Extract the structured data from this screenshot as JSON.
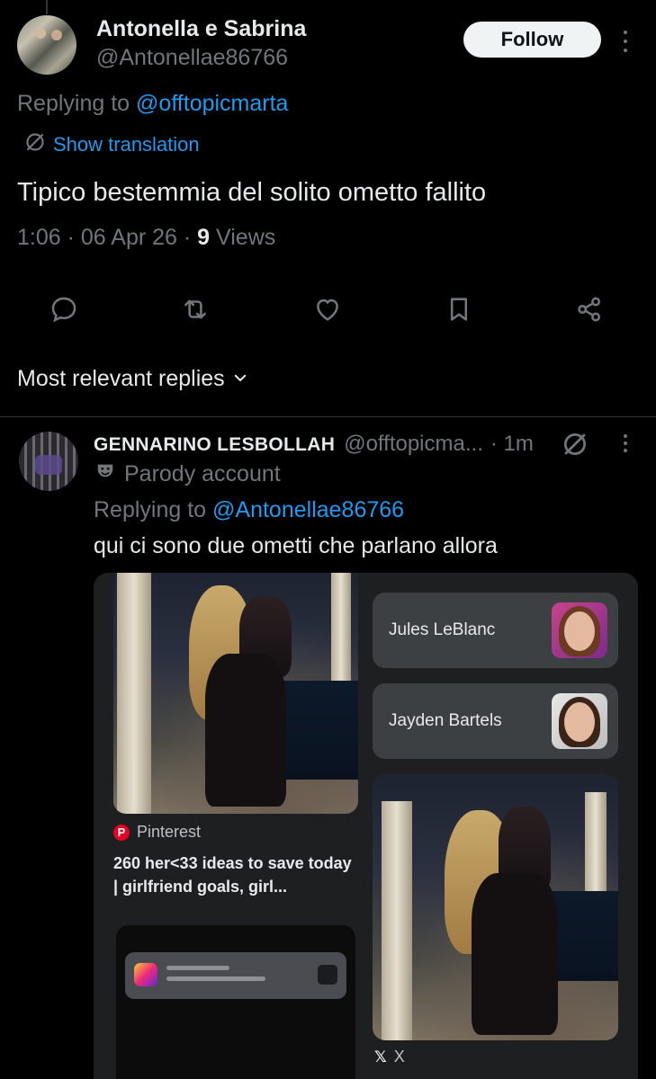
{
  "tweet": {
    "author_name": "Antonella e Sabrina",
    "author_handle": "@Antonellae86766",
    "follow_label": "Follow",
    "replying_prefix": "Replying to",
    "replying_to": "@offtopicmarta",
    "translate_label": "Show translation",
    "text": "Tipico bestemmia del solito ometto fallito",
    "time": "1:06",
    "date": "06 Apr 26",
    "views_count": "9",
    "views_label": "Views",
    "separator": "·"
  },
  "actions": [
    "reply-icon",
    "retweet-icon",
    "like-icon",
    "bookmark-icon",
    "share-icon"
  ],
  "replies_sort": {
    "label": "Most relevant replies"
  },
  "reply": {
    "author_name": "GENNARINO LESBOLLAH",
    "author_handle": "@offtopicma...",
    "time": "· 1m",
    "badge_label": "Parody account",
    "replying_prefix": "Replying to",
    "replying_to": "@Antonellae86766",
    "text": "qui ci sono due ometti che parlano allora"
  },
  "card": {
    "source_name": "Pinterest",
    "source_title": "260 her<33 ideas to save today | girlfriend goals, girl...",
    "chips": [
      {
        "label": "Jules LeBlanc"
      },
      {
        "label": "Jayden Bartels"
      }
    ],
    "second_source": "X"
  },
  "colors": {
    "background": "#000000",
    "text": "#e7e9ea",
    "muted": "#71767b",
    "link": "#1d9bf0",
    "follow_bg": "#eff3f4",
    "card_bg": "#1e1f20",
    "chip_bg": "#3c4043"
  }
}
